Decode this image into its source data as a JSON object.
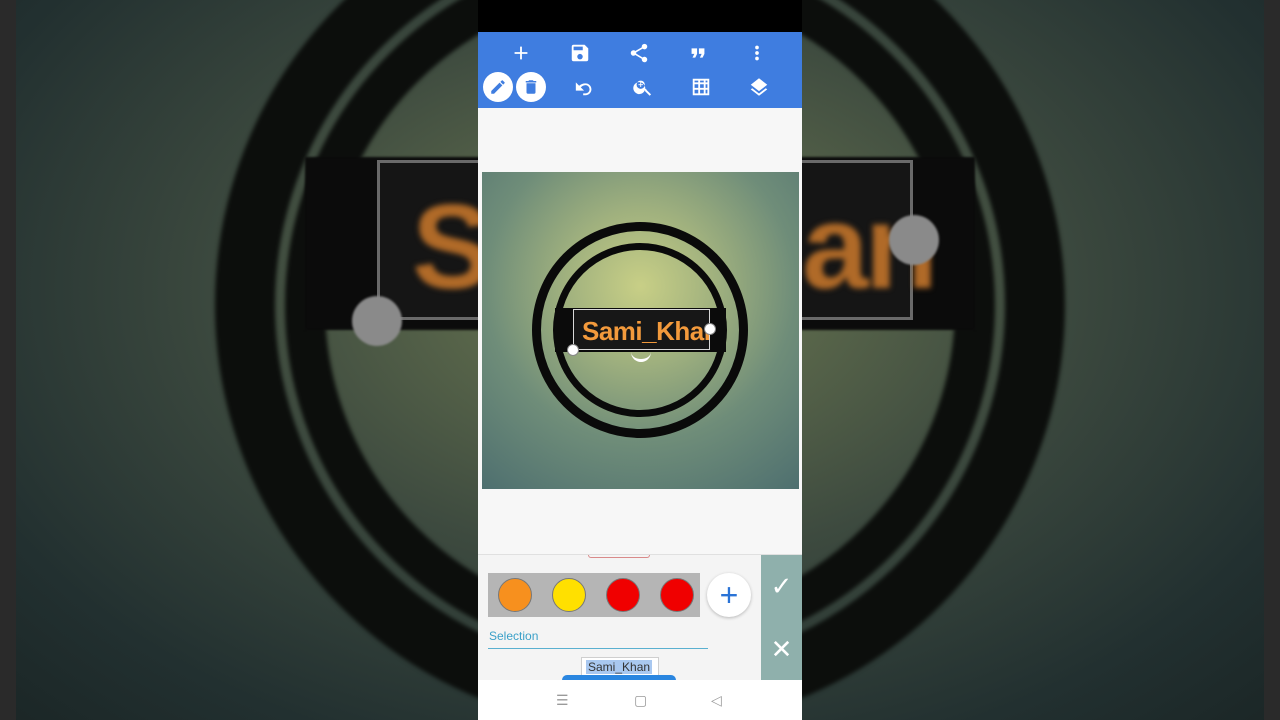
{
  "toolbar": {
    "row1": [
      "add-icon",
      "save-icon",
      "share-icon",
      "quote-icon",
      "more-vert-icon"
    ],
    "row2": [
      "pencil-icon",
      "trash-icon",
      "undo-icon",
      "zoom-in-icon",
      "grid-icon",
      "layers-icon"
    ]
  },
  "canvas": {
    "label_text": "Sami_Khan",
    "text_color": "#f39a3c"
  },
  "background": {
    "blurred_text": "Sami_Khan"
  },
  "panel": {
    "swatches": [
      {
        "color": "#f7901e"
      },
      {
        "color": "#ffe000"
      },
      {
        "color": "#f00000"
      },
      {
        "color": "#f00000"
      }
    ],
    "add_label": "+",
    "selection_label": "Selection",
    "text_value": "Sami_Khan",
    "confirm_label": "✓",
    "cancel_label": "✕"
  },
  "navbar": {
    "menu": "☰",
    "home": "▢",
    "back": "◁"
  }
}
